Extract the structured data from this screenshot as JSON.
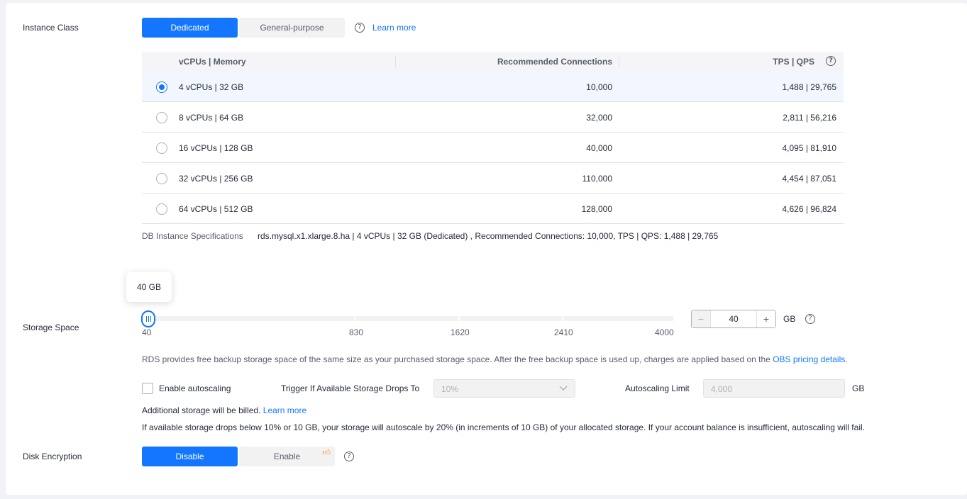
{
  "instance_class": {
    "label": "Instance Class",
    "options": [
      "Dedicated",
      "General-purpose"
    ],
    "selected": "Dedicated",
    "learn_more": "Learn more"
  },
  "table": {
    "headers": [
      "vCPUs | Memory",
      "Recommended Connections",
      "TPS | QPS"
    ],
    "rows": [
      {
        "spec": "4 vCPUs | 32 GB",
        "connections": "10,000",
        "tps_qps": "1,488 | 29,765",
        "selected": true
      },
      {
        "spec": "8 vCPUs | 64 GB",
        "connections": "32,000",
        "tps_qps": "2,811 | 56,216",
        "selected": false
      },
      {
        "spec": "16 vCPUs | 128 GB",
        "connections": "40,000",
        "tps_qps": "4,095 | 81,910",
        "selected": false
      },
      {
        "spec": "32 vCPUs | 256 GB",
        "connections": "110,000",
        "tps_qps": "4,454 | 87,051",
        "selected": false
      },
      {
        "spec": "64 vCPUs | 512 GB",
        "connections": "128,000",
        "tps_qps": "4,626 | 96,824",
        "selected": false
      }
    ]
  },
  "db_spec": {
    "label": "DB Instance Specifications",
    "value": "rds.mysql.x1.xlarge.8.ha | 4 vCPUs | 32 GB (Dedicated) , Recommended Connections: 10,000, TPS | QPS: 1,488 | 29,765"
  },
  "storage": {
    "label": "Storage Space",
    "tooltip": "40 GB",
    "slider_value": 40,
    "marks": [
      "40",
      "830",
      "1620",
      "2410",
      "4000"
    ],
    "stepper_value": "40",
    "unit": "GB",
    "minus": "−",
    "plus": "+",
    "note_prefix": "RDS provides free backup storage space of the same size as your purchased storage space. After the free backup space is used up, charges are applied based on the ",
    "note_link": "OBS pricing details",
    "note_suffix": "."
  },
  "autoscaling": {
    "enable_label": "Enable autoscaling",
    "enabled": false,
    "trigger_label": "Trigger If Available Storage Drops To",
    "trigger_value": "10%",
    "limit_label": "Autoscaling Limit",
    "limit_value": "4,000",
    "limit_unit": "GB",
    "billed_text": "Additional storage will be billed.",
    "learn_more": "Learn more",
    "info": "If available storage drops below 10% or 10 GB, your storage will autoscale by 20% (in increments of 10 GB) of your allocated storage. If your account balance is insufficient, autoscaling will fail."
  },
  "disk_encryption": {
    "label": "Disk Encryption",
    "options": [
      "Disable",
      "Enable"
    ],
    "selected": "Disable",
    "badge_icon": "thumbs-up-icon"
  },
  "colors": {
    "accent": "#1476ff",
    "selected_row": "#f1f6ff",
    "text": "#252b3a",
    "muted": "#575d6c"
  }
}
